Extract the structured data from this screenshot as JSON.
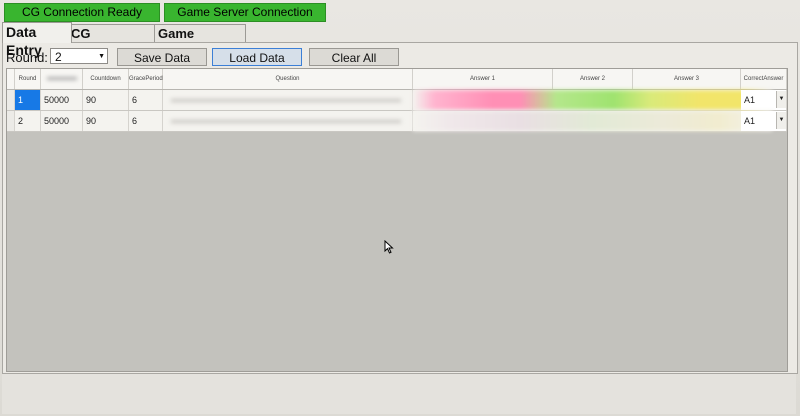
{
  "status": {
    "cg_connection": "CG Connection Ready",
    "game_server": "Game Server Connection",
    "color": "#39b52f"
  },
  "tabs": [
    {
      "label": "Data Entry",
      "active": true
    },
    {
      "label": "CG Rehearsal",
      "active": false
    },
    {
      "label": "Game Control",
      "active": false
    }
  ],
  "controls": {
    "round_label": "Round:",
    "round_value": "2",
    "buttons": [
      "Save Data",
      "Load Data",
      "Clear All"
    ]
  },
  "grid": {
    "headers": [
      "Round",
      "",
      "Countdown",
      "GracePeriod",
      "Question",
      "Answer 1",
      "Answer 2",
      "Answer 3",
      "CorrectAnswer"
    ],
    "rows": [
      {
        "round": "1",
        "prize": "50000",
        "countdown": "90",
        "grace": "6",
        "correct": "A1"
      },
      {
        "round": "2",
        "prize": "50000",
        "countdown": "90",
        "grace": "6",
        "correct": "A1"
      }
    ],
    "answer_colors": [
      "#ff8fb5",
      "#9fe36f",
      "#f2e56a"
    ]
  }
}
